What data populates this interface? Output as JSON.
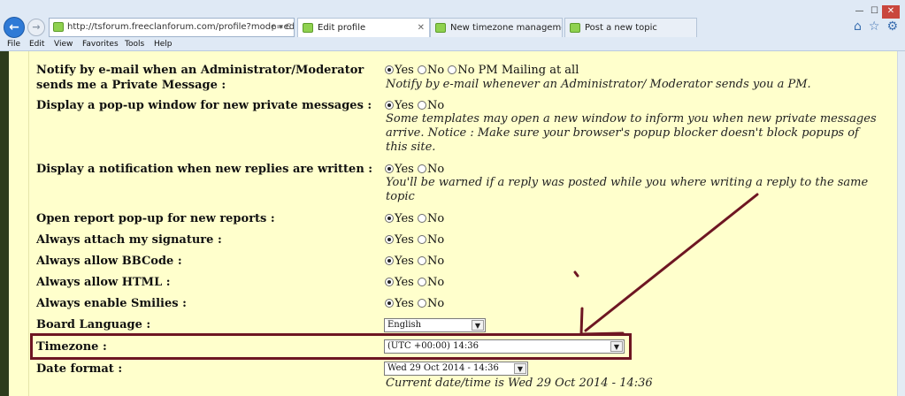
{
  "browser": {
    "url": "http://tsforum.freeclanforum.com/profile?mode=edit",
    "url_controls": "ρ ▾ C",
    "tabs": [
      {
        "label": "Edit profile",
        "close": "✕"
      },
      {
        "label": "New timezone management"
      },
      {
        "label": "Post a new topic"
      }
    ],
    "window_buttons": [
      "—",
      "☐",
      "✕"
    ],
    "toolbar_icons": [
      "⌂",
      "☆",
      "⚙"
    ],
    "back_glyph": "←",
    "forward_glyph": "→",
    "menu": [
      "File",
      "Edit",
      "View",
      "Favorites",
      "Tools",
      "Help"
    ]
  },
  "form": {
    "yes_label": "Yes",
    "no_label": "No",
    "notify_pm": {
      "label": "Notify by e-mail when an Administrator/Moderator sends me a Private Message :",
      "option3": "No PM Mailing at all",
      "desc": "Notify by e-mail whenever an Administrator/ Moderator sends you a PM."
    },
    "popup_pm": {
      "label": "Display a pop-up window for new private messages :",
      "desc": "Some templates may open a new window to inform you when new private messages arrive. Notice : Make sure your browser's popup blocker doesn't block popups of this site."
    },
    "reply_notification": {
      "label": "Display a notification when new replies are written :",
      "desc": "You'll be warned if a reply was posted while you where writing a reply to the same topic"
    },
    "report_popup": {
      "label": "Open report pop-up for new reports :"
    },
    "attach_signature": {
      "label": "Always attach my signature :"
    },
    "allow_bbcode": {
      "label": "Always allow BBCode :"
    },
    "allow_html": {
      "label": "Always allow HTML :"
    },
    "enable_smilies": {
      "label": "Always enable Smilies :"
    },
    "board_language": {
      "label": "Board Language :",
      "value": "English"
    },
    "timezone": {
      "label": "Timezone :",
      "value": "(UTC +00:00) 14:36"
    },
    "date_format": {
      "label": "Date format :",
      "value": "Wed 29 Oct 2014 - 14:36",
      "desc": "Current date/time is Wed 29 Oct 2014 - 14:36"
    }
  },
  "annotation": {
    "color": "#6e1622"
  }
}
